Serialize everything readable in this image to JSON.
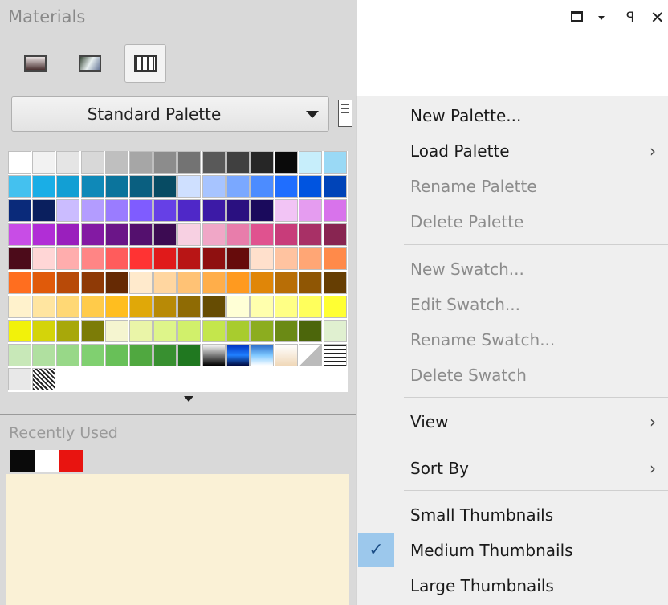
{
  "panel": {
    "title": "Materials",
    "palette_selector": {
      "value": "Standard Palette"
    },
    "recently_used_label": "Recently Used",
    "recent_colors": [
      "#0a0a0a",
      "#ffffff",
      "#e81410"
    ]
  },
  "window_controls": {
    "maximize_icon": "square-icon",
    "menu_icon": "triangle-down-icon",
    "pin_icon": "pin-icon",
    "close_icon": "close-icon"
  },
  "toolbar": {
    "buttons": [
      {
        "name": "color-view",
        "icon": "gradient-square-icon",
        "active": false
      },
      {
        "name": "texture-view",
        "icon": "texture-icon",
        "active": false
      },
      {
        "name": "swatch-view",
        "icon": "grid-icon",
        "active": true
      }
    ]
  },
  "swatches": [
    "#ffffff",
    "#f2f2f2",
    "#e5e5e5",
    "#d8d8d8",
    "#bfbfbf",
    "#a6a6a6",
    "#8c8c8c",
    "#737373",
    "#595959",
    "#404040",
    "#262626",
    "#0a0a0a",
    "#c7eefb",
    "#9ad9f5",
    "#44c1ef",
    "#1aaee6",
    "#129fd4",
    "#0f89b8",
    "#0b749c",
    "#0a5f80",
    "#074b63",
    "#cfe0ff",
    "#a7c4ff",
    "#7aa8ff",
    "#4c8cff",
    "#1f6eff",
    "#0054e0",
    "#0044b8",
    "#0a2a7a",
    "#0a1f5e",
    "#cbbcff",
    "#b39cff",
    "#9a7cff",
    "#7f5cff",
    "#6640e6",
    "#4f28c8",
    "#3c1aa6",
    "#2a1080",
    "#1a0a5c",
    "#f2c4f5",
    "#e59cf0",
    "#d873eb",
    "#c84de6",
    "#b12ed6",
    "#9a1fbd",
    "#831aa3",
    "#6b1588",
    "#54106e",
    "#3c0b52",
    "#f7d0e2",
    "#f0a7c7",
    "#e87dab",
    "#e0528f",
    "#c83c7a",
    "#a83066",
    "#882551",
    "#4c0b1a",
    "#ffd6d6",
    "#ffadad",
    "#ff8585",
    "#ff5c5c",
    "#ff3333",
    "#e01a1a",
    "#b81515",
    "#8f1010",
    "#660b0b",
    "#ffe0cc",
    "#ffc3a0",
    "#ffa675",
    "#ff8a4a",
    "#ff6e1f",
    "#e05a0a",
    "#b84a08",
    "#8f3a06",
    "#662a04",
    "#ffeacc",
    "#ffd6a0",
    "#ffc275",
    "#ffae4a",
    "#ff9a1f",
    "#e08608",
    "#b86e06",
    "#8f5604",
    "#663e03",
    "#fff2cc",
    "#ffe5a0",
    "#ffd875",
    "#ffcb4a",
    "#ffbe1f",
    "#e0a808",
    "#b88a06",
    "#8f6b04",
    "#664c03",
    "#ffffd6",
    "#ffffad",
    "#ffff85",
    "#ffff5c",
    "#ffff33",
    "#f2f20a",
    "#d4d40a",
    "#a8a80a",
    "#7c7c07",
    "#f5f5d0",
    "#eaf5a8",
    "#def58a",
    "#d1f06b",
    "#c4e64c",
    "#a8cc2e",
    "#8cad1f",
    "#6b8a15",
    "#4c660b",
    "#e0f0d0",
    "#c8e8b8",
    "#b0e0a0",
    "#98d888",
    "#80d070",
    "#68c058",
    "#50a840",
    "#389030",
    "#207820",
    "#grad1",
    "#grad2",
    "#grad3",
    "#grad4",
    "#grad5",
    "#grad6",
    "#e8e8e8",
    "#pattern"
  ],
  "menu": {
    "items": [
      {
        "label": "New Palette...",
        "enabled": true,
        "submenu": false
      },
      {
        "label": "Load Palette",
        "enabled": true,
        "submenu": true
      },
      {
        "label": "Rename Palette",
        "enabled": false,
        "submenu": false
      },
      {
        "label": "Delete Palette",
        "enabled": false,
        "submenu": false
      },
      {
        "label": "New Swatch...",
        "enabled": false,
        "submenu": false
      },
      {
        "label": "Edit Swatch...",
        "enabled": false,
        "submenu": false
      },
      {
        "label": "Rename Swatch...",
        "enabled": false,
        "submenu": false
      },
      {
        "label": "Delete Swatch",
        "enabled": false,
        "submenu": false
      },
      {
        "label": "View",
        "enabled": true,
        "submenu": true
      },
      {
        "label": "Sort By",
        "enabled": true,
        "submenu": true
      },
      {
        "label": "Small Thumbnails",
        "enabled": true,
        "submenu": false
      },
      {
        "label": "Medium Thumbnails",
        "enabled": true,
        "submenu": false,
        "checked": true
      },
      {
        "label": "Large Thumbnails",
        "enabled": true,
        "submenu": false
      }
    ],
    "submenu_glyph": "›",
    "check_glyph": "✓"
  }
}
